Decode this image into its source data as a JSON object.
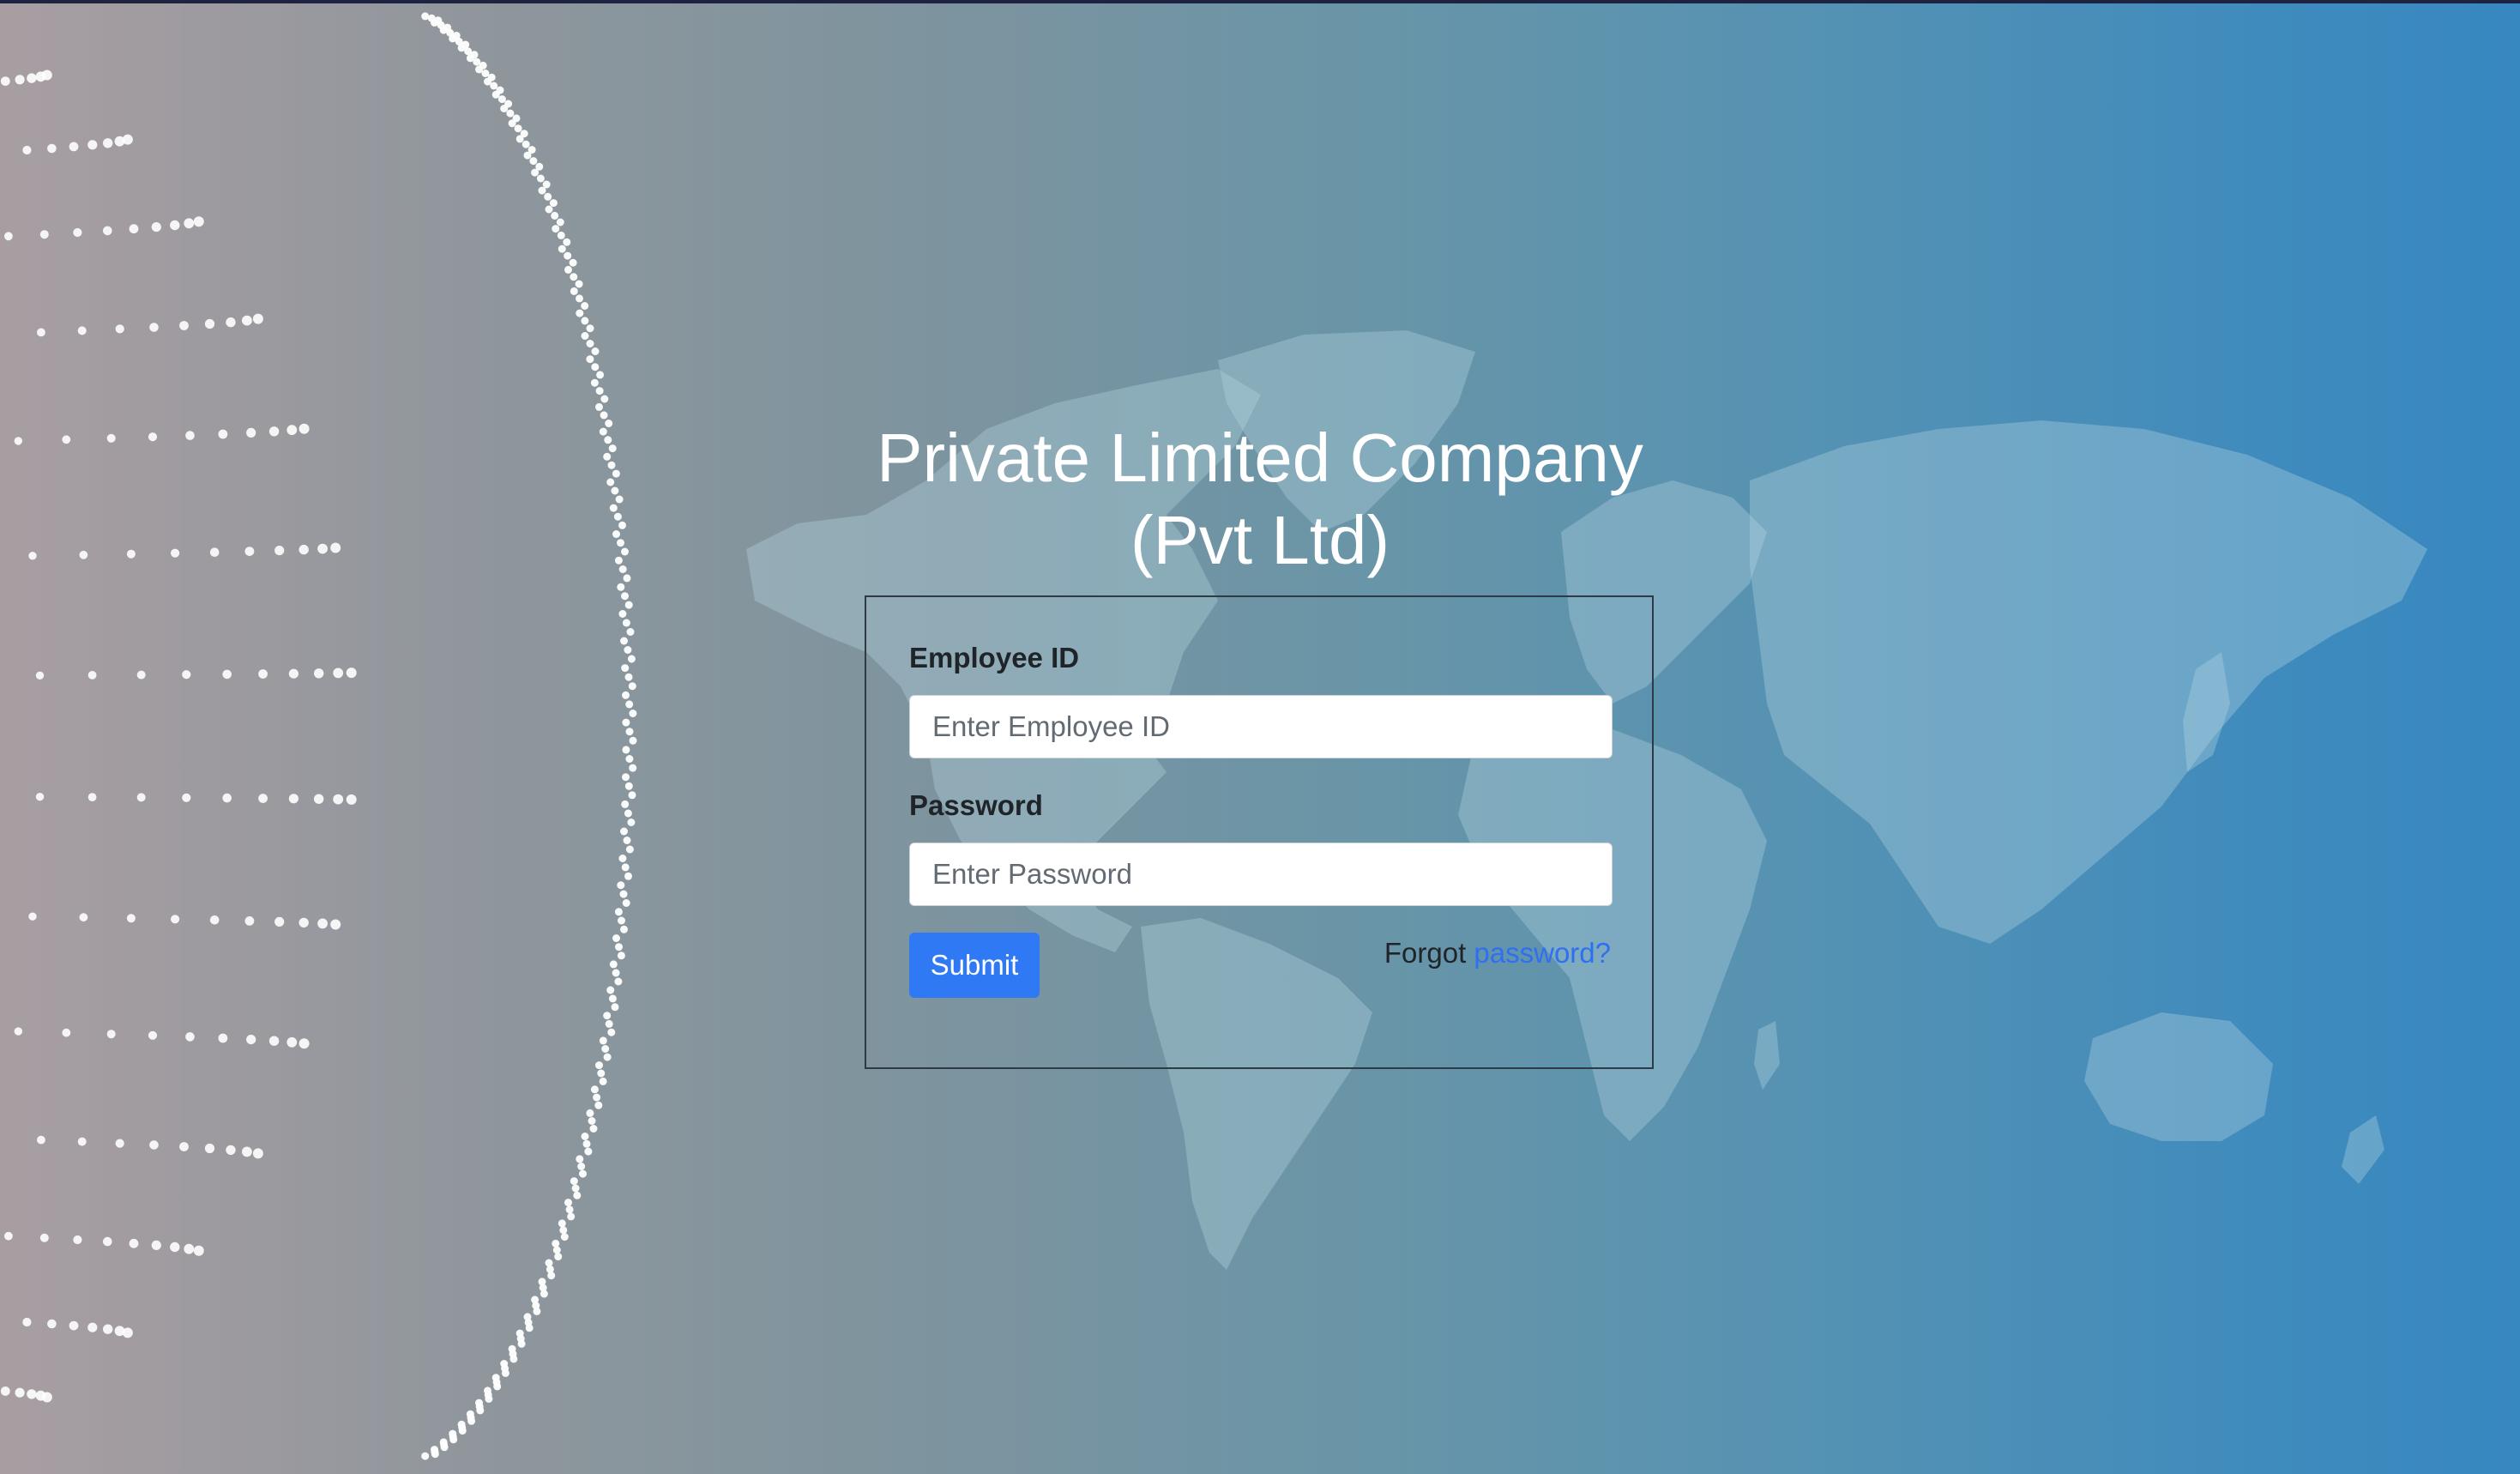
{
  "page": {
    "title_line1": "Private Limited Company",
    "title_line2": "(Pvt Ltd)"
  },
  "login_form": {
    "employee_id_label": "Employee ID",
    "employee_id_placeholder": "Enter Employee ID",
    "employee_id_value": "",
    "password_label": "Password",
    "password_placeholder": "Enter Password",
    "password_value": "",
    "submit_label": "Submit",
    "forgot_prefix": "Forgot",
    "forgot_link": "password?"
  },
  "background": {
    "graphic_left": "dotted-globe-icon",
    "graphic_center": "world-map-icon"
  },
  "colors": {
    "accent": "#2f7af4",
    "link": "#2f6ff0",
    "title": "#ffffff",
    "gradient_left": "#a89ea2",
    "gradient_right": "#3787c0"
  }
}
